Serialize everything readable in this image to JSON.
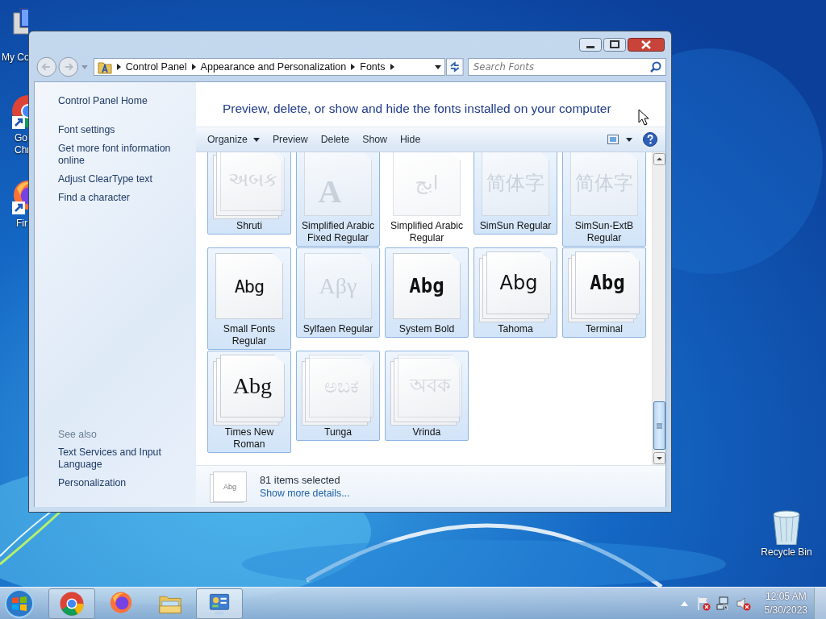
{
  "desktop_icons": [
    {
      "kind": "computer",
      "label_lines": [
        "My Co"
      ]
    },
    {
      "kind": "chrome",
      "label_lines": [
        "Go",
        "Chr"
      ]
    },
    {
      "kind": "firefox",
      "label_lines": [
        "Fir"
      ]
    },
    {
      "kind": "bin",
      "label_lines": [
        "Recycle Bin"
      ]
    }
  ],
  "window": {
    "address": {
      "breadcrumbs": [
        "Control Panel",
        "Appearance and Personalization",
        "Fonts"
      ]
    },
    "search": {
      "placeholder": "Search Fonts"
    },
    "sidebar": {
      "links": [
        "Control Panel Home",
        "Font settings",
        "Get more font information online",
        "Adjust ClearType text",
        "Find a character"
      ],
      "see_also_heading": "See also",
      "see_also": [
        "Text Services and Input Language",
        "Personalization"
      ]
    },
    "header": "Preview, delete, or show and hide the fonts installed on your computer",
    "toolbar": [
      {
        "label": "Organize",
        "dropdown": true
      },
      {
        "label": "Preview",
        "dropdown": false
      },
      {
        "label": "Delete",
        "dropdown": false
      },
      {
        "label": "Show",
        "dropdown": false
      },
      {
        "label": "Hide",
        "dropdown": false
      }
    ],
    "fonts": [
      {
        "name": "Shruti",
        "sample": "અબક",
        "kind": "sans",
        "stacked": true,
        "hidden": true,
        "selected": true
      },
      {
        "name": "Simplified Arabic Fixed Regular",
        "sample": "A",
        "kind": "serifbig",
        "stacked": false,
        "hidden": true,
        "selected": true
      },
      {
        "name": "Simplified Arabic Regular",
        "sample": "ابج",
        "kind": "sans",
        "stacked": false,
        "hidden": true,
        "selected": false
      },
      {
        "name": "SimSun Regular",
        "sample": "简体字",
        "kind": "sans",
        "stacked": false,
        "hidden": true,
        "selected": true
      },
      {
        "name": "SimSun-ExtB Regular",
        "sample": "简体字",
        "kind": "sans",
        "stacked": false,
        "hidden": true,
        "selected": true
      },
      {
        "name": "Small Fonts Regular",
        "sample": "Abg",
        "kind": "pixel",
        "stacked": false,
        "hidden": false,
        "selected": true
      },
      {
        "name": "Sylfaen Regular",
        "sample": "Aβγ",
        "kind": "serif",
        "stacked": false,
        "hidden": true,
        "selected": true
      },
      {
        "name": "System Bold",
        "sample": "Abg",
        "kind": "bold",
        "stacked": false,
        "hidden": false,
        "selected": true
      },
      {
        "name": "Tahoma",
        "sample": "Abg",
        "kind": "sans",
        "stacked": true,
        "hidden": false,
        "selected": true
      },
      {
        "name": "Terminal",
        "sample": "Abg",
        "kind": "bold",
        "stacked": true,
        "hidden": false,
        "selected": true
      },
      {
        "name": "Times New Roman",
        "sample": "Abg",
        "kind": "serif",
        "stacked": true,
        "hidden": false,
        "selected": true
      },
      {
        "name": "Tunga",
        "sample": "ಅಬಕ",
        "kind": "sans",
        "stacked": true,
        "hidden": true,
        "selected": true
      },
      {
        "name": "Vrinda",
        "sample": "অবক",
        "kind": "sans",
        "stacked": true,
        "hidden": true,
        "selected": true
      }
    ],
    "details": {
      "thumbnail_text": "Abg",
      "count": "81 items selected",
      "link": "Show more details..."
    }
  },
  "taskbar": {
    "apps": [
      {
        "kind": "chrome",
        "running": true,
        "active": false
      },
      {
        "kind": "firefox",
        "running": false,
        "active": false
      },
      {
        "kind": "explorer",
        "running": false,
        "active": false
      },
      {
        "kind": "control-panel",
        "running": true,
        "active": true
      }
    ],
    "clock": {
      "time": "12:05 AM",
      "date": "5/30/2023"
    }
  }
}
